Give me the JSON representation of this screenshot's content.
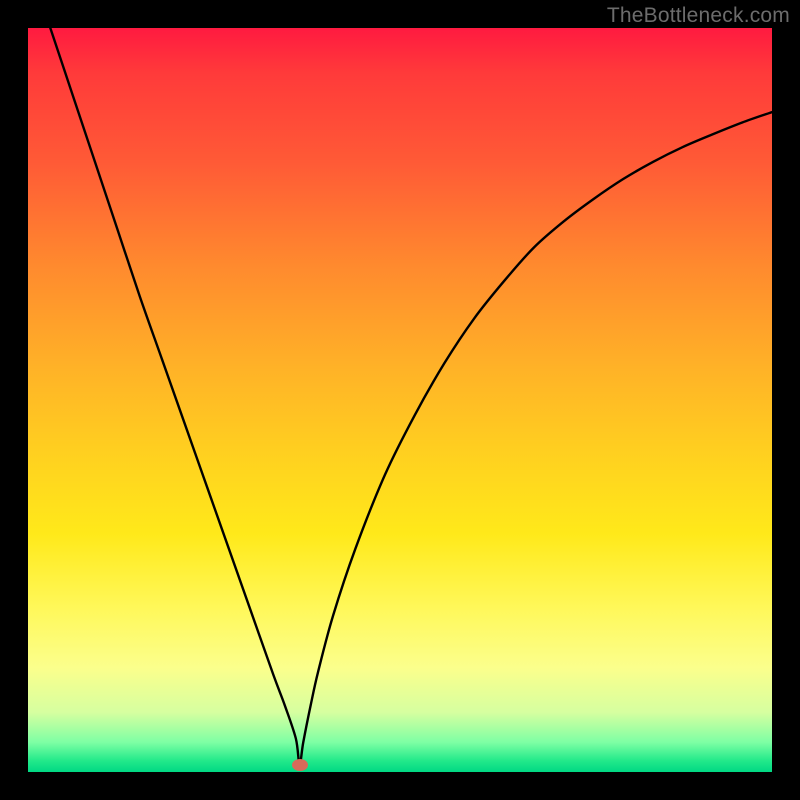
{
  "watermark": "TheBottleneck.com",
  "chart_data": {
    "type": "line",
    "title": "",
    "xlabel": "",
    "ylabel": "",
    "xlim": [
      0,
      100
    ],
    "ylim": [
      0,
      100
    ],
    "grid": false,
    "legend": false,
    "marker": {
      "x": 36.5,
      "y": 1,
      "color": "#d86a5a"
    },
    "series": [
      {
        "name": "bottleneck-curve",
        "color": "#000000",
        "x": [
          3,
          6,
          9,
          12,
          15,
          18,
          21,
          24,
          27,
          30,
          33,
          34.5,
          36,
          36.5,
          37,
          38,
          39,
          41,
          44,
          48,
          52,
          56,
          60,
          64,
          68,
          72,
          76,
          80,
          84,
          88,
          92,
          96,
          100
        ],
        "y": [
          100,
          91,
          82,
          73,
          64,
          55.5,
          47,
          38.5,
          30,
          21.5,
          13,
          9,
          4.5,
          1,
          4,
          9,
          13.5,
          21,
          30,
          40,
          48,
          55,
          61,
          66,
          70.5,
          74,
          77,
          79.7,
          82,
          84,
          85.7,
          87.3,
          88.7
        ]
      }
    ],
    "background_gradient": {
      "direction": "top-to-bottom",
      "stops": [
        {
          "pos": 0.0,
          "color": "#ff1a40"
        },
        {
          "pos": 0.3,
          "color": "#ff8a2e"
        },
        {
          "pos": 0.6,
          "color": "#ffd21f"
        },
        {
          "pos": 0.85,
          "color": "#fbff8c"
        },
        {
          "pos": 0.96,
          "color": "#7effa4"
        },
        {
          "pos": 1.0,
          "color": "#00d884"
        }
      ]
    }
  }
}
